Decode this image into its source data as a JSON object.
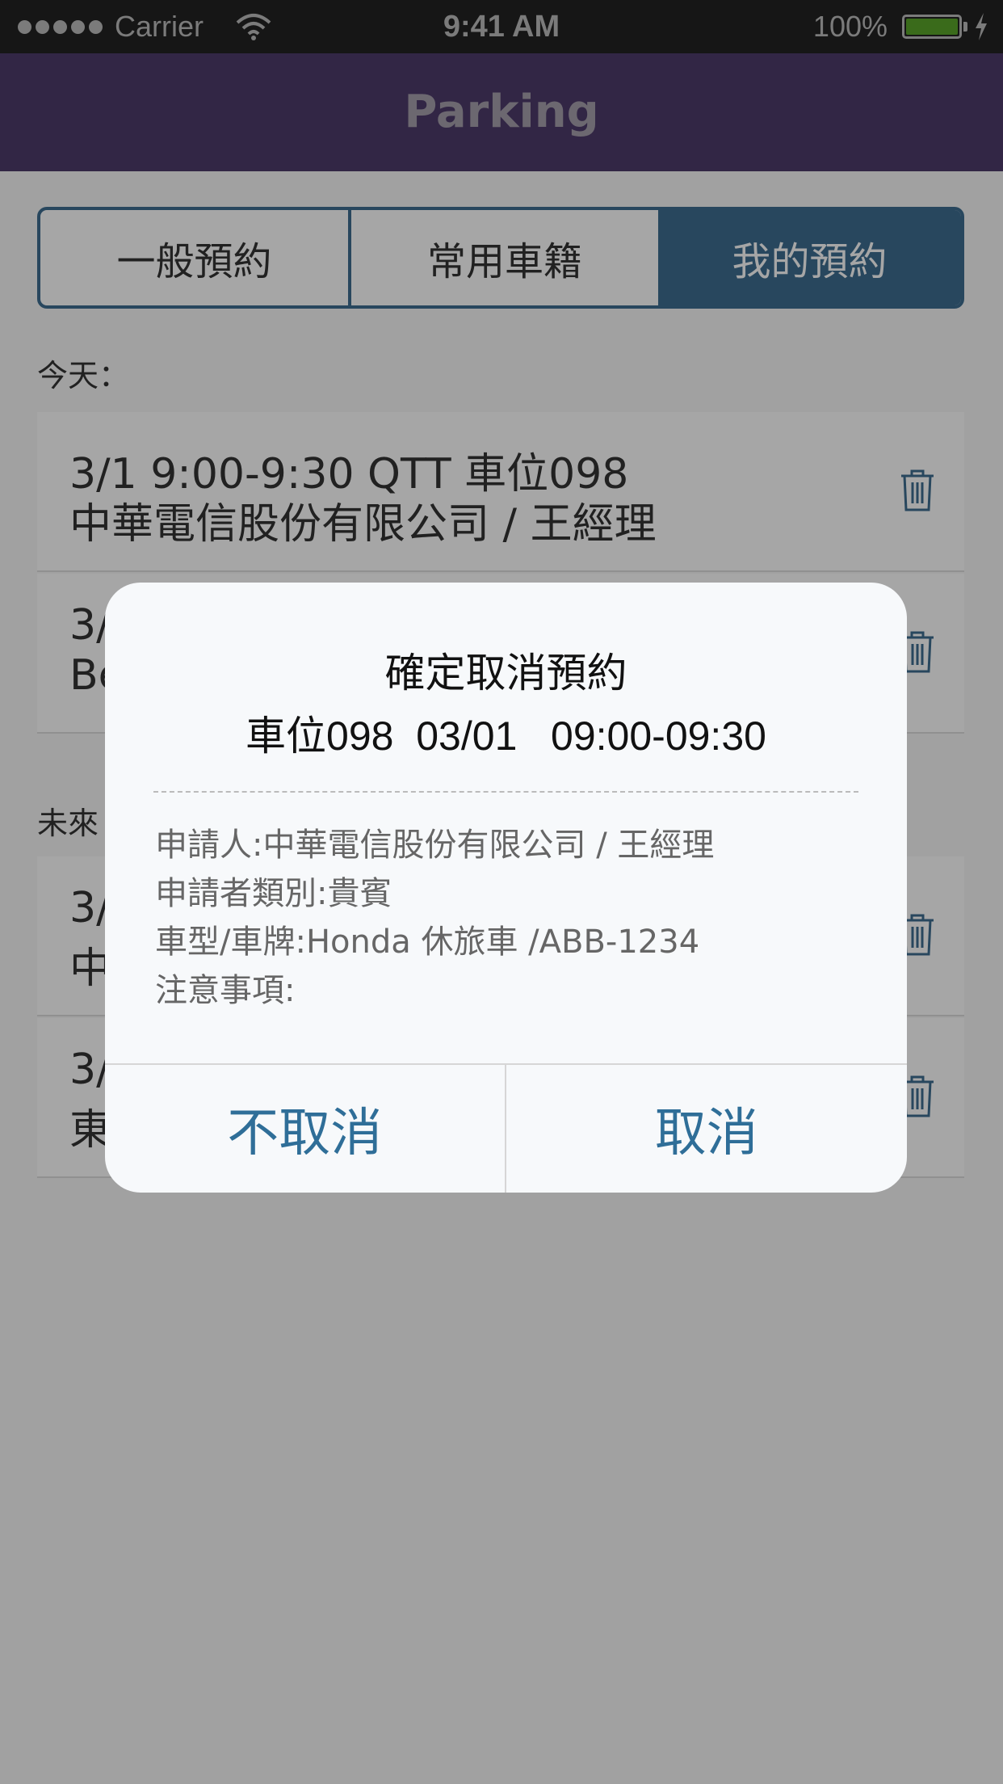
{
  "status_bar": {
    "carrier": "Carrier",
    "time": "9:41 AM",
    "battery_percent": "100%",
    "battery_level": 1.0
  },
  "nav": {
    "title": "Parking"
  },
  "tabs": [
    {
      "label": "一般預約",
      "selected": false
    },
    {
      "label": "常用車籍",
      "selected": false
    },
    {
      "label": "我的預約",
      "selected": true
    }
  ],
  "sections": {
    "today_label": "今天：",
    "future_label": "未來"
  },
  "reservations": [
    {
      "line1": "3/1  9:00-9:30  QTT 車位098",
      "line2": "中華電信股份有限公司 / 王經理"
    },
    {
      "line1": "3/",
      "line2": "Be"
    },
    {
      "line1": "3/",
      "line2": "中"
    },
    {
      "line1": "3/",
      "line2": "東"
    }
  ],
  "dialog": {
    "title": "確定取消預約",
    "subtitle": "車位098  03/01   09:00-09:30",
    "applicant": "申請人:中華電信股份有限公司 / 王經理",
    "applicant_type": "申請者類別:貴賓",
    "vehicle": "車型/車牌:Honda 休旅車 /ABB-1234",
    "notes": "注意事項:",
    "btn_keep": "不取消",
    "btn_cancel": "取消"
  },
  "colors": {
    "nav_bg": "#4e3b6b",
    "accent": "#3e6e91",
    "dialog_button_text": "#2f6e98"
  }
}
